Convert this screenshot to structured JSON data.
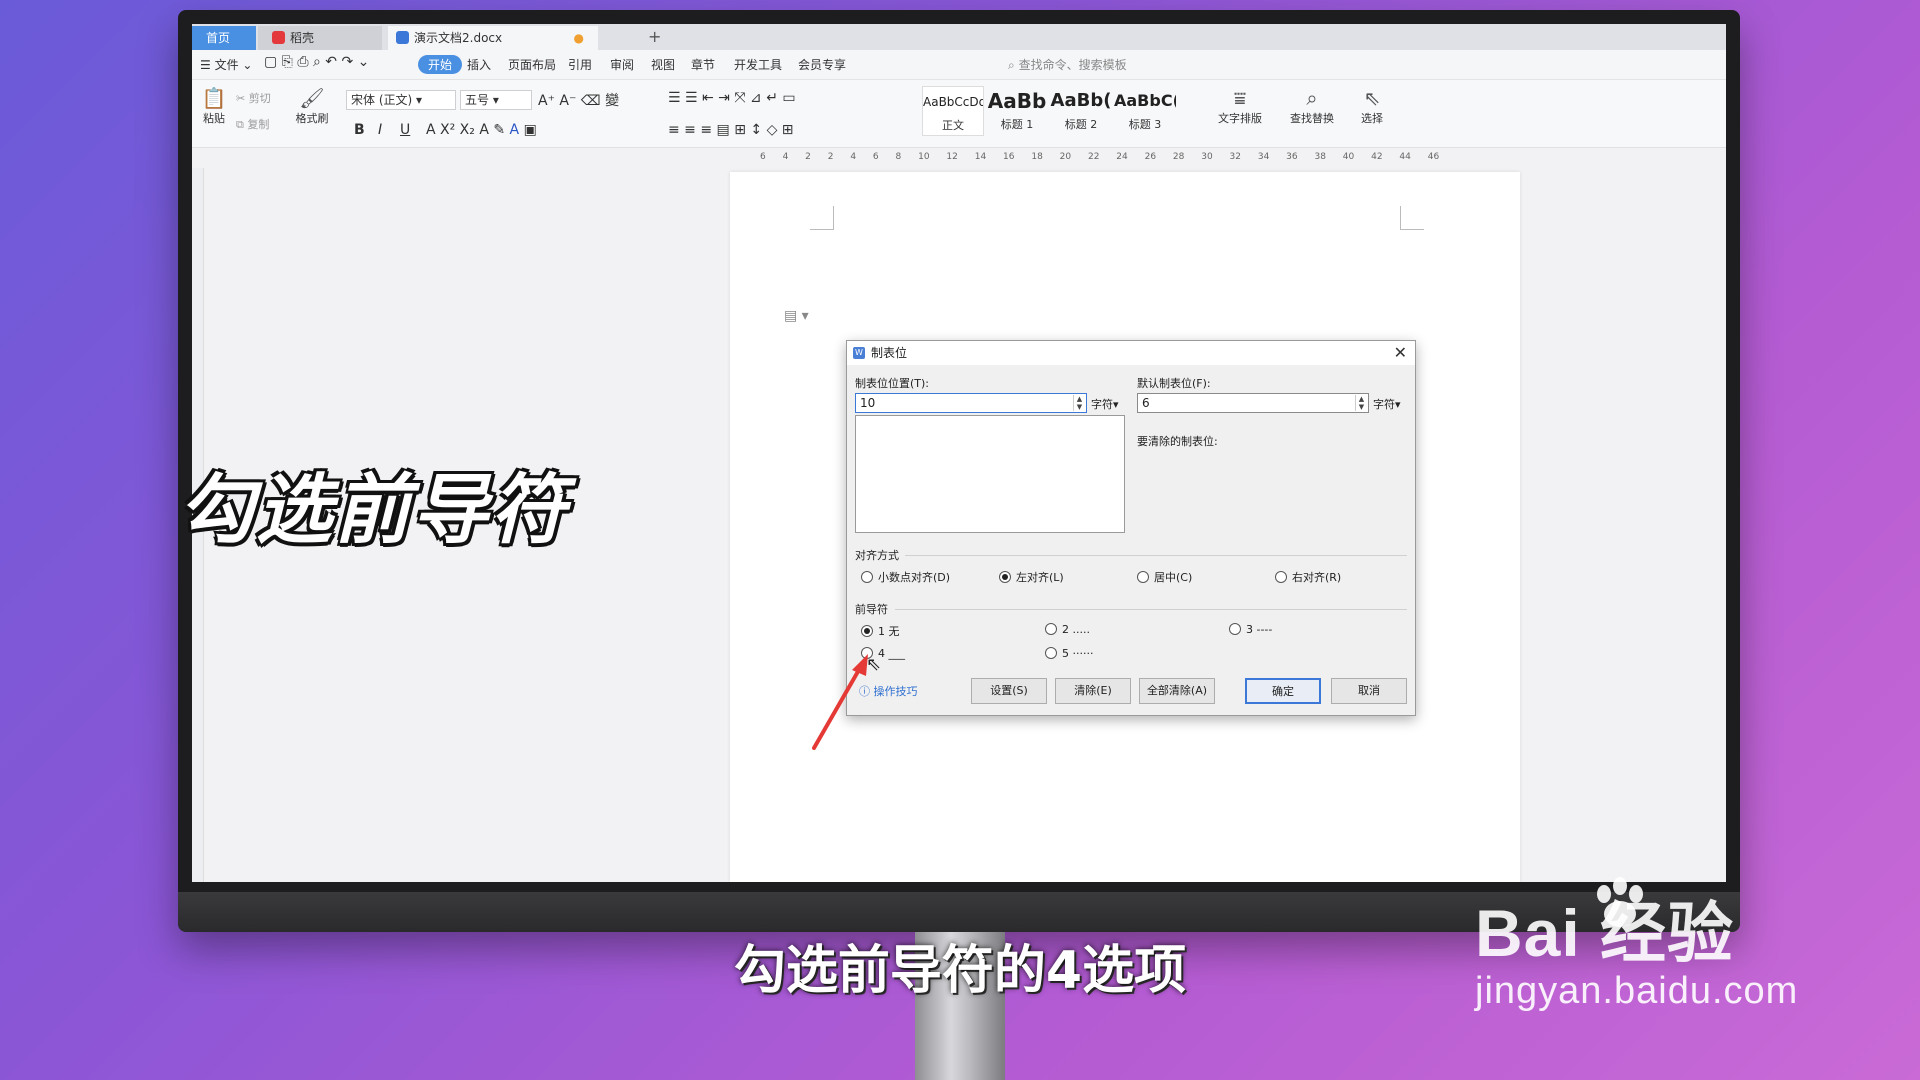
{
  "tabs": {
    "home": "首页",
    "daoke": "稻壳",
    "doc": "演示文档2.docx"
  },
  "menu": {
    "file": "文件",
    "items": [
      "开始",
      "插入",
      "页面布局",
      "引用",
      "审阅",
      "视图",
      "章节",
      "开发工具",
      "会员专享"
    ],
    "search_placeholder": "查找命令、搜索模板"
  },
  "ribbon": {
    "paste": "粘贴",
    "cut": "剪切",
    "copy": "复制",
    "format_painter": "格式刷",
    "font": "宋体 (正文)",
    "size": "五号",
    "styles": [
      {
        "preview": "AaBbCcDd",
        "label": "正文"
      },
      {
        "preview": "AaBb",
        "label": "标题 1"
      },
      {
        "preview": "AaBb(",
        "label": "标题 2"
      },
      {
        "preview": "AaBbC(",
        "label": "标题 3"
      }
    ],
    "text_layout": "文字排版",
    "find_replace": "查找替换",
    "select": "选择"
  },
  "ruler": "6 4 2 2 4 6 8 10 12 14 16 18 20 22 24 26 28 30 32 34 36 38 40 42 44 46",
  "dialog": {
    "title": "制表位",
    "tab_pos_label": "制表位位置(T):",
    "tab_pos_value": "10",
    "unit": "字符",
    "default_label": "默认制表位(F):",
    "default_value": "6",
    "clear_label": "要清除的制表位:",
    "align_label": "对齐方式",
    "align_options": [
      "小数点对齐(D)",
      "左对齐(L)",
      "居中(C)",
      "右对齐(R)"
    ],
    "align_selected": 1,
    "leader_label": "前导符",
    "leader_options": [
      "1 无",
      "2 .....",
      "3 ----",
      "4 ___",
      "5 ······"
    ],
    "leader_selected": 0,
    "tips": "操作技巧",
    "buttons": {
      "set": "设置(S)",
      "clear": "清除(E)",
      "clear_all": "全部清除(A)",
      "ok": "确定",
      "cancel": "取消"
    }
  },
  "overlay": {
    "big_caption": "勾选前导符",
    "subtitle": "勾选前导符的4选项",
    "watermark_main": "Bai 经验",
    "watermark_sub": "jingyan.baidu.com"
  }
}
